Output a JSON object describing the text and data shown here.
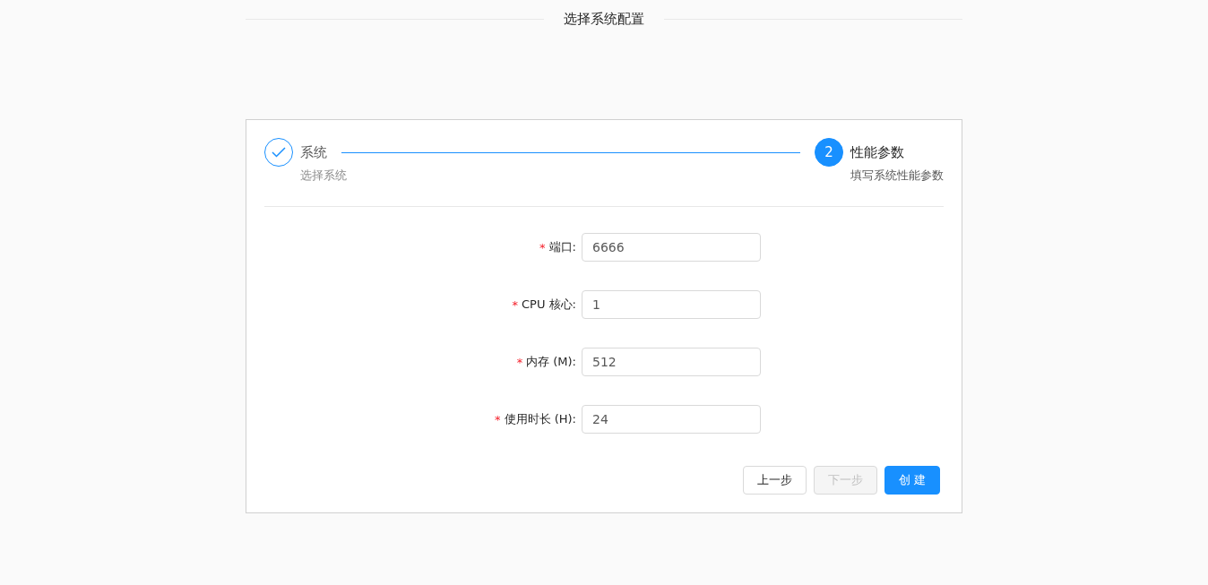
{
  "header": {
    "title": "选择系统配置"
  },
  "steps": [
    {
      "title": "系统",
      "description": "选择系统",
      "done": true
    },
    {
      "number": "2",
      "title": "性能参数",
      "description": "填写系统性能参数",
      "done": false
    }
  ],
  "form": {
    "fields": [
      {
        "required": "*",
        "label": "端口:",
        "value": "6666"
      },
      {
        "required": "*",
        "label": "CPU 核心:",
        "value": "1"
      },
      {
        "required": "*",
        "label": "内存 (M):",
        "value": "512"
      },
      {
        "required": "*",
        "label": "使用时长 (H):",
        "value": "24"
      }
    ]
  },
  "buttons": [
    {
      "label": "上一步",
      "kind": "default",
      "disabled": false
    },
    {
      "label": "下一步",
      "kind": "default",
      "disabled": true
    },
    {
      "label": "创 建",
      "kind": "primary",
      "disabled": false
    }
  ]
}
